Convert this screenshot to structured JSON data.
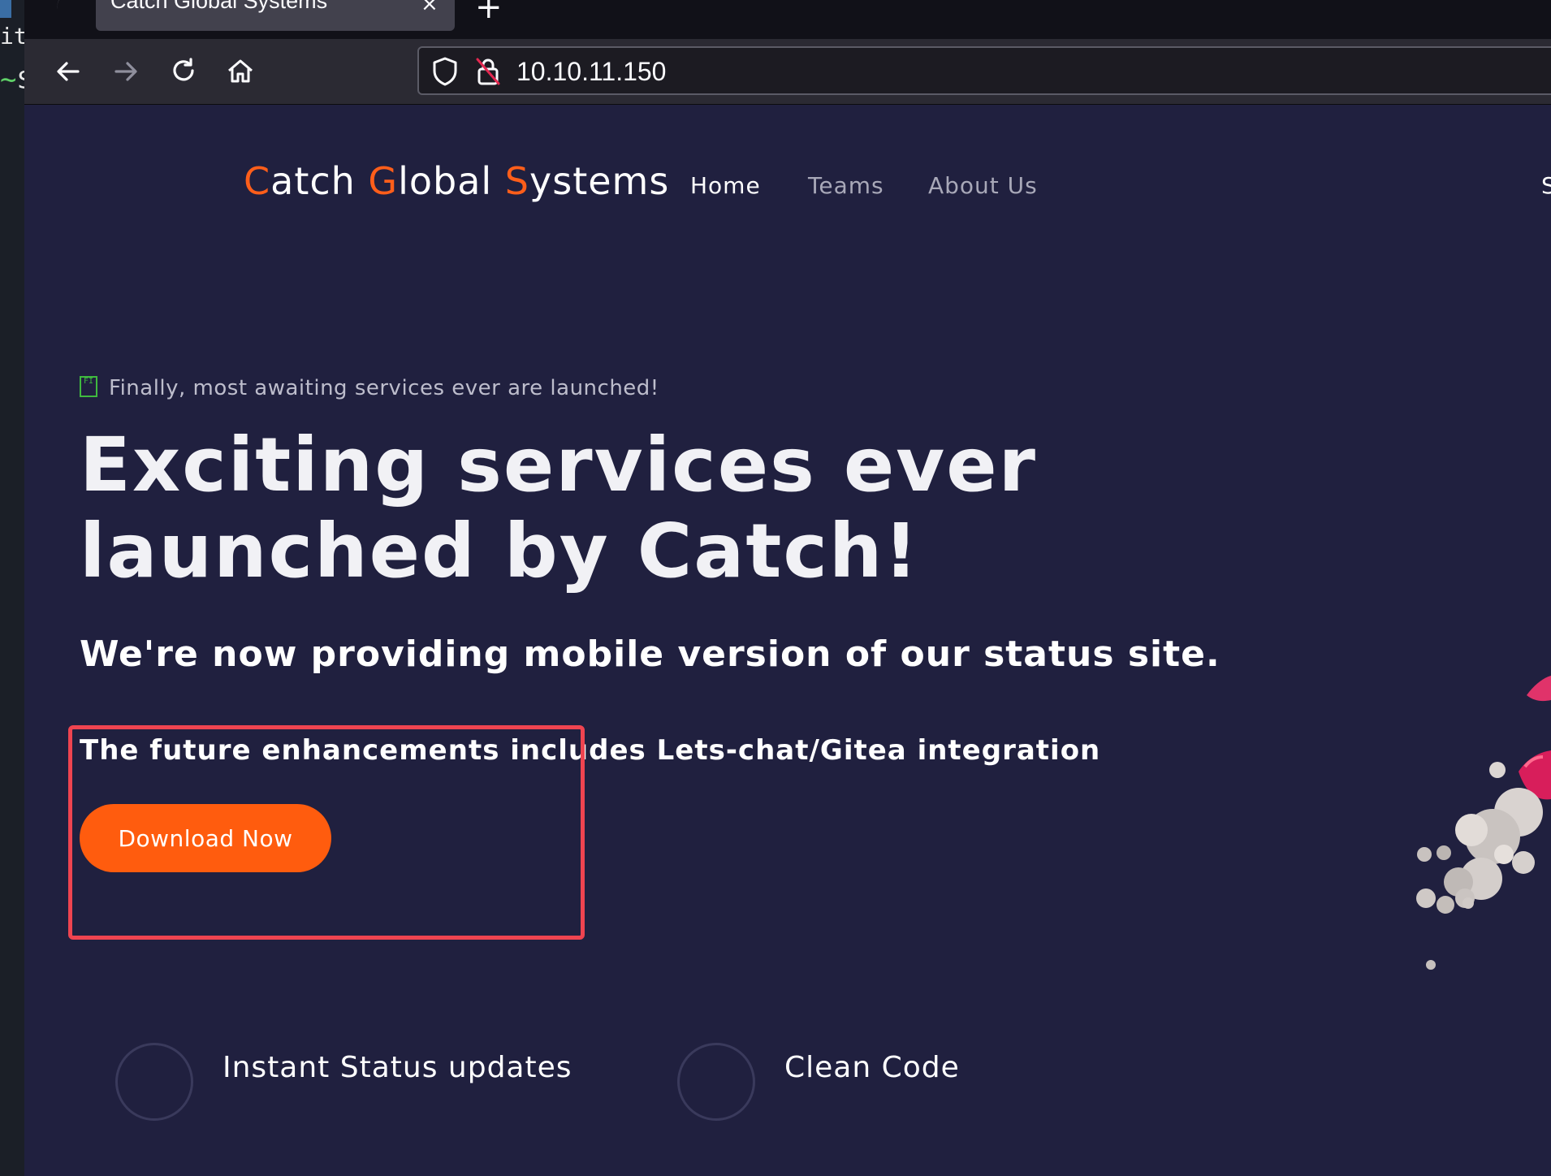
{
  "terminal": {
    "line1": "it",
    "line2_prefix": "~",
    "line2_prompt": "$"
  },
  "browser": {
    "tab_title": "Catch Global Systems",
    "tab_close": "×",
    "new_tab": "+",
    "url": "10.10.11.150"
  },
  "site": {
    "logo": {
      "c": "C",
      "atch": "atch ",
      "g": "G",
      "lobal": "lobal ",
      "s": "S",
      "ystems": "ystems"
    },
    "nav": [
      {
        "label": "Home",
        "active": true
      },
      {
        "label": "Teams",
        "active": false
      },
      {
        "label": "About Us",
        "active": false
      }
    ],
    "nav_cut": "S"
  },
  "hero": {
    "badge_glyph": "FI",
    "tagline": "Finally, most awaiting services ever are launched!",
    "heading": "Exciting services ever launched by Catch!",
    "subtitle": "We're now providing mobile version of our status site.",
    "enhancements": "The future enhancements includes  Lets-chat/Gitea integration",
    "button": "Download Now"
  },
  "features": [
    {
      "label": "Instant Status updates"
    },
    {
      "label": "Clean Code"
    }
  ],
  "colors": {
    "accent": "#ff5c0e",
    "page_bg": "#20203f",
    "highlight_border": "#ef4450"
  }
}
